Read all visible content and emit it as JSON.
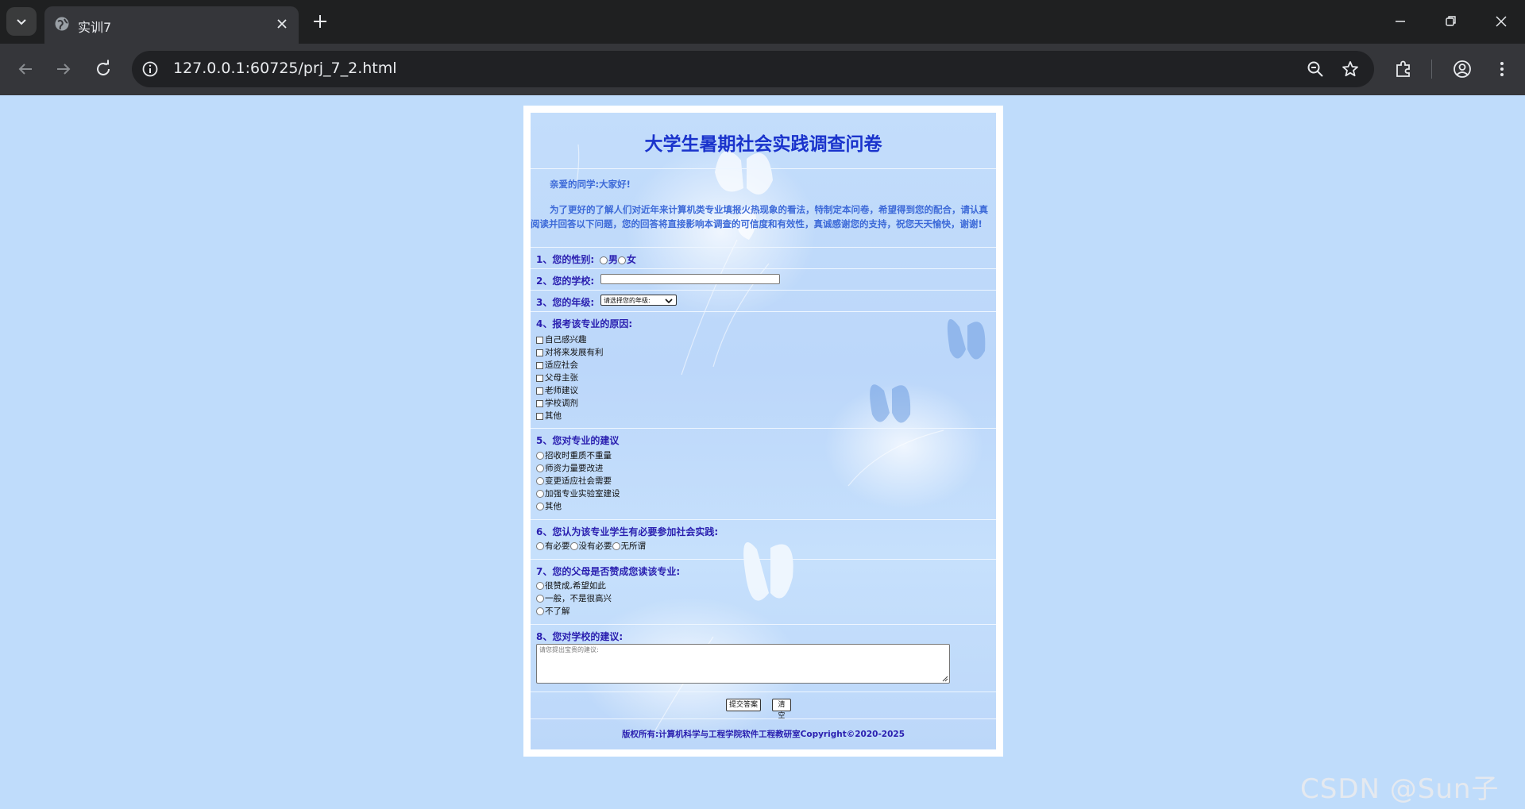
{
  "browser": {
    "tab_title": "实训7",
    "url": "127.0.0.1:60725/prj_7_2.html"
  },
  "survey": {
    "title": "大学生暑期社会实践调查问卷",
    "greeting": "亲爱的同学:大家好!",
    "intro": "为了更好的了解人们对近年来计算机类专业填报火热现象的看法，特制定本问卷，希望得到您的配合，请认真阅读并回答以下问题，您的回答将直接影响本调查的可信度和有效性，真诚感谢您的支持，祝您天天愉快，谢谢!",
    "q1": {
      "label": "1、您的性别:",
      "options": [
        "男",
        "女"
      ]
    },
    "q2": {
      "label": "2、您的学校:",
      "value": ""
    },
    "q3": {
      "label": "3、您的年级:",
      "selected": "请选择您的年级:"
    },
    "q4": {
      "label": "4、报考该专业的原因:",
      "options": [
        "自己感兴趣",
        "对将来发展有利",
        "适应社会",
        "父母主张",
        "老师建议",
        "学校调剂",
        "其他"
      ]
    },
    "q5": {
      "label": "5、您对专业的建议",
      "options": [
        "招收时重质不重量",
        "师资力量要改进",
        "变更适应社会需要",
        "加强专业实验室建设",
        "其他"
      ]
    },
    "q6": {
      "label": "6、您认为该专业学生有必要参加社会实践:",
      "options": [
        "有必要",
        "没有必要",
        "无所谓"
      ]
    },
    "q7": {
      "label": "7、您的父母是否赞成您读该专业:",
      "options": [
        "很赞成,希望如此",
        "一般，不是很高兴",
        "不了解"
      ]
    },
    "q8": {
      "label": "8、您对学校的建议:",
      "placeholder": "请您提出宝贵的建议:"
    },
    "submit_label": "提交答案",
    "reset_label": "清空",
    "copyright": "版权所有:计算机科学与工程学院软件工程教研室Copyright©2020-2025"
  },
  "watermark": "CSDN @Sun子矜",
  "icons": {
    "tab_favicon": "globe-icon",
    "info": "info-icon",
    "zoom": "zoom-out-icon",
    "bookmark": "star-icon"
  }
}
